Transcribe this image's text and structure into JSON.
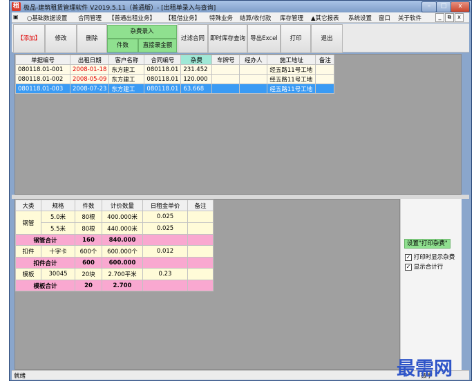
{
  "window": {
    "title": "极品-建筑租赁管理软件 V2019.5.11（普通版）- [出租单录入与查询]",
    "logo_text": "租",
    "controls": [
      "–",
      "□",
      "x"
    ]
  },
  "menubar": {
    "items": [
      "○基础数据设置",
      "合同管理",
      "【普通出租业务】",
      "【租借业务】",
      "特殊业务",
      "结算/收付款",
      "库存管理",
      "▲其它报表",
      "系统设置",
      "窗口",
      "关于软件"
    ],
    "mdi_controls": [
      "_",
      "⧉",
      "x"
    ]
  },
  "toolbar": {
    "add": "【添加】",
    "edit": "修改",
    "delete": "删除",
    "misc_entry": "杂费录入",
    "item_count": "件数",
    "direct_amount": "直接录金额",
    "filter_contract": "过滤合同",
    "realtime_stock": "即时库存查询",
    "export_excel": "导出Excel",
    "print": "打印",
    "exit": "退出"
  },
  "orders_table": {
    "headers": [
      "单据编号",
      "出租日期",
      "客户名称",
      "合同编号",
      "杂费",
      "车牌号",
      "经办人",
      "施工地址",
      "备注"
    ],
    "rows": [
      [
        "080118.01-001",
        "2008-01-18",
        "东方建工",
        "080118.01",
        "231.452",
        "",
        "",
        "经五路11号工地",
        ""
      ],
      [
        "080118.01-002",
        "2008-05-09",
        "东方建工",
        "080118.01",
        "120.000",
        "",
        "",
        "经五路11号工地",
        ""
      ],
      [
        "080118.01-003",
        "2008-07-23",
        "东方建工",
        "080118.01",
        "63.668",
        "",
        "",
        "经五路11号工地",
        ""
      ]
    ],
    "selected_row": 2
  },
  "detail_table": {
    "headers": [
      "大类",
      "规格",
      "件数",
      "计价数量",
      "日租金单价",
      "备注"
    ],
    "groups": [
      {
        "category": "钢管",
        "rows": [
          [
            "5.0米",
            "80根",
            "400.000米",
            "0.025",
            ""
          ],
          [
            "5.5米",
            "80根",
            "440.000米",
            "0.025",
            ""
          ]
        ],
        "subtotal": {
          "label": "钢管合计",
          "count": "160",
          "qty": "840.000"
        }
      },
      {
        "category": "扣件",
        "rows": [
          [
            "十字卡",
            "600个",
            "600.000个",
            "0.012",
            ""
          ]
        ],
        "subtotal": {
          "label": "扣件合计",
          "count": "600",
          "qty": "600.000"
        }
      },
      {
        "category": "模板",
        "rows": [
          [
            "30045",
            "20块",
            "2.700平米",
            "0.23",
            ""
          ]
        ],
        "subtotal": {
          "label": "模板合计",
          "count": "20",
          "qty": "2.700"
        }
      }
    ]
  },
  "side_panel": {
    "print_button": "设置\"打印杂费\"",
    "show_fees": "打印时显示杂费",
    "show_totals": "显示合计行"
  },
  "statusbar": {
    "left": "就绪",
    "right": "数字"
  },
  "watermark": "最需网",
  "colors": {
    "accent_green": "#8fe08f",
    "selection_blue": "#3a9bf4",
    "subtotal_pink": "#f9a8d0",
    "date_red": "#e00000"
  }
}
